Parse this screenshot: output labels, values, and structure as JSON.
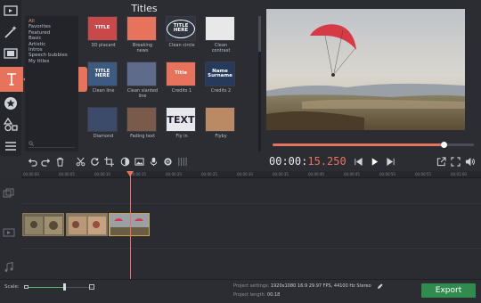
{
  "panel": {
    "heading": "Titles"
  },
  "callout": {
    "label": "Titles"
  },
  "categories": [
    "All",
    "Favorites",
    "Featured",
    "Basic",
    "Artistic",
    "Intros",
    "Speech bubbles",
    "My titles"
  ],
  "tiles": [
    {
      "caption": "3D placard",
      "text": "TITLE",
      "style": "placard"
    },
    {
      "caption": "Breaking news",
      "text": "",
      "style": "breaking"
    },
    {
      "caption": "Clean circle",
      "text": "TITLE HERE",
      "style": "circle"
    },
    {
      "caption": "Clean contrast",
      "text": "",
      "style": "contrast"
    },
    {
      "caption": "Clean line",
      "text": "TITLE HERE",
      "style": "line"
    },
    {
      "caption": "Clean slanted line",
      "text": "",
      "style": "slanted"
    },
    {
      "caption": "Credits 1",
      "text": "Title",
      "style": "credits1"
    },
    {
      "caption": "Credits 2",
      "text": "Name Surname",
      "style": "credits2"
    },
    {
      "caption": "Diamond",
      "text": "",
      "style": "diamond"
    },
    {
      "caption": "Fading text",
      "text": "",
      "style": "fading"
    },
    {
      "caption": "Fly in",
      "text": "TEXT",
      "style": "flyin"
    },
    {
      "caption": "Flyby",
      "text": "",
      "style": "flyby"
    }
  ],
  "timecode": {
    "main": "00:00:",
    "frac": "15.250"
  },
  "ruler_ticks": [
    "00:00:00",
    "00:00:05",
    "00:00:10",
    "00:00:15",
    "00:00:20",
    "00:00:25",
    "00:00:30",
    "00:00:35",
    "00:00:40",
    "00:00:45",
    "00:00:50",
    "00:00:55",
    "00:01:00"
  ],
  "bottom": {
    "scale_label": "Scale:",
    "settings_label": "Project settings:",
    "settings_value": "1920x1080 16:9 29.97 FPS, 44100 Hz Stereo",
    "length_label": "Project length:",
    "length_value": "00:18",
    "export_label": "Export"
  },
  "colors": {
    "accent": "#e8735c",
    "export": "#2f8c4d",
    "bg": "#2b2d33"
  },
  "progress": {
    "scrubber": 0.86,
    "scale": 0.57
  }
}
